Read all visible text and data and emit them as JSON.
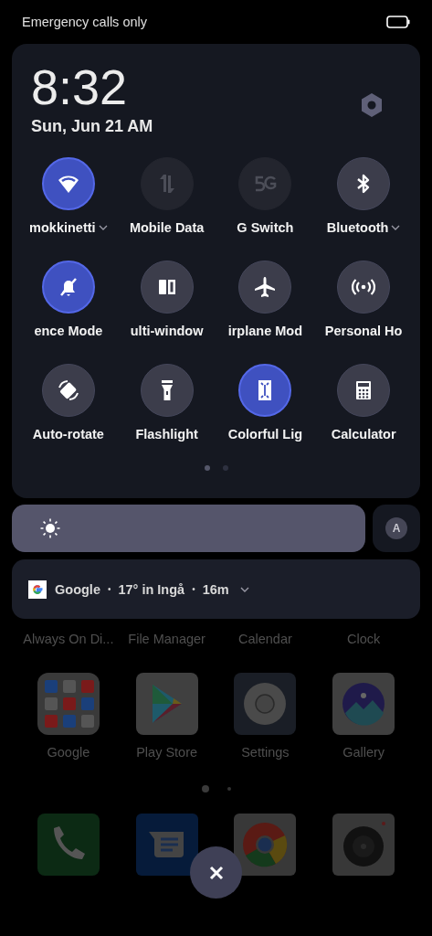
{
  "status_bar": {
    "carrier": "Emergency calls only"
  },
  "panel": {
    "time": "8:32",
    "date": "Sun, Jun 21 AM",
    "tiles": [
      {
        "label": "mokkinetti",
        "on": true,
        "disabled": false,
        "has_menu": true
      },
      {
        "label": "Mobile Data",
        "on": false,
        "disabled": true,
        "has_menu": false
      },
      {
        "label": "G Switch",
        "on": false,
        "disabled": true,
        "has_menu": false
      },
      {
        "label": "Bluetooth",
        "on": false,
        "disabled": false,
        "has_menu": true
      },
      {
        "label": "ence Mode",
        "on": true,
        "disabled": false,
        "has_menu": false
      },
      {
        "label": "ulti-window",
        "on": false,
        "disabled": false,
        "has_menu": false
      },
      {
        "label": "irplane Mod",
        "on": false,
        "disabled": false,
        "has_menu": false
      },
      {
        "label": "Personal Ho",
        "on": false,
        "disabled": false,
        "has_menu": false
      },
      {
        "label": "Auto-rotate",
        "on": false,
        "disabled": false,
        "has_menu": false
      },
      {
        "label": "Flashlight",
        "on": false,
        "disabled": false,
        "has_menu": false
      },
      {
        "label": "Colorful Lig",
        "on": true,
        "disabled": false,
        "has_menu": false
      },
      {
        "label": "Calculator",
        "on": false,
        "disabled": false,
        "has_menu": false
      }
    ],
    "pages": [
      {
        "selected": true
      },
      {
        "selected": false
      }
    ]
  },
  "brightness": {
    "level": 1,
    "auto_label": "A"
  },
  "notification": {
    "app": "Google",
    "separator": "•",
    "text": "17° in Ingå",
    "time": "16m"
  },
  "home": {
    "hidden_row": [
      {
        "label": "Always On Di..."
      },
      {
        "label": "File Manager"
      },
      {
        "label": "Calendar"
      },
      {
        "label": "Clock"
      }
    ],
    "apps": [
      {
        "label": "Google"
      },
      {
        "label": "Play Store"
      },
      {
        "label": "Settings"
      },
      {
        "label": "Gallery"
      }
    ],
    "pages": [
      {
        "selected": true
      },
      {
        "selected": false
      }
    ]
  }
}
